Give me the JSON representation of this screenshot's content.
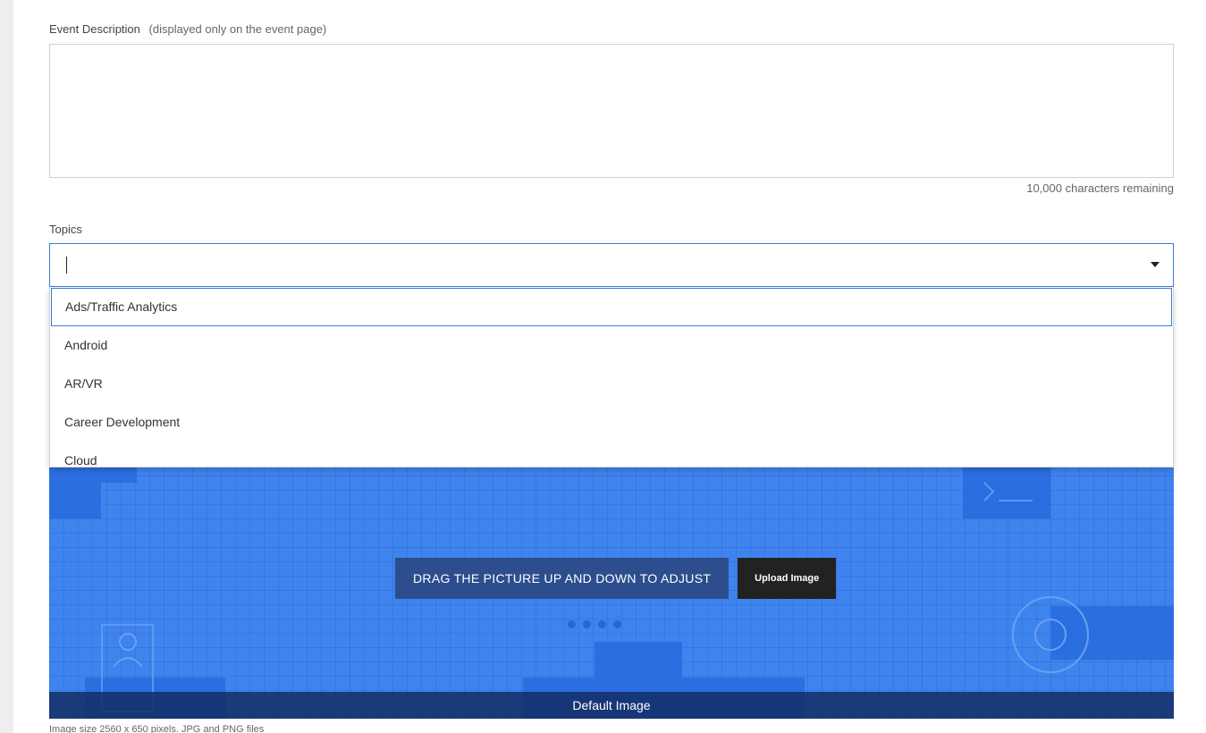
{
  "description": {
    "label": "Event Description",
    "hint": "(displayed only on the event page)",
    "value": "",
    "chars_remaining": "10,000 characters remaining"
  },
  "topics": {
    "label": "Topics",
    "value": "",
    "options": [
      "Ads/Traffic Analytics",
      "Android",
      "AR/VR",
      "Career Development",
      "Cloud"
    ]
  },
  "banner": {
    "drag_label": "DRAG THE PICTURE UP AND DOWN TO ADJUST",
    "upload_label": "Upload Image",
    "default_label": "Default Image",
    "size_note": "Image size 2560 x 650 pixels. JPG and PNG files"
  },
  "colors": {
    "accent": "#3a7bd5",
    "banner_bg": "#3f84ee",
    "upload_button": "#222222"
  }
}
